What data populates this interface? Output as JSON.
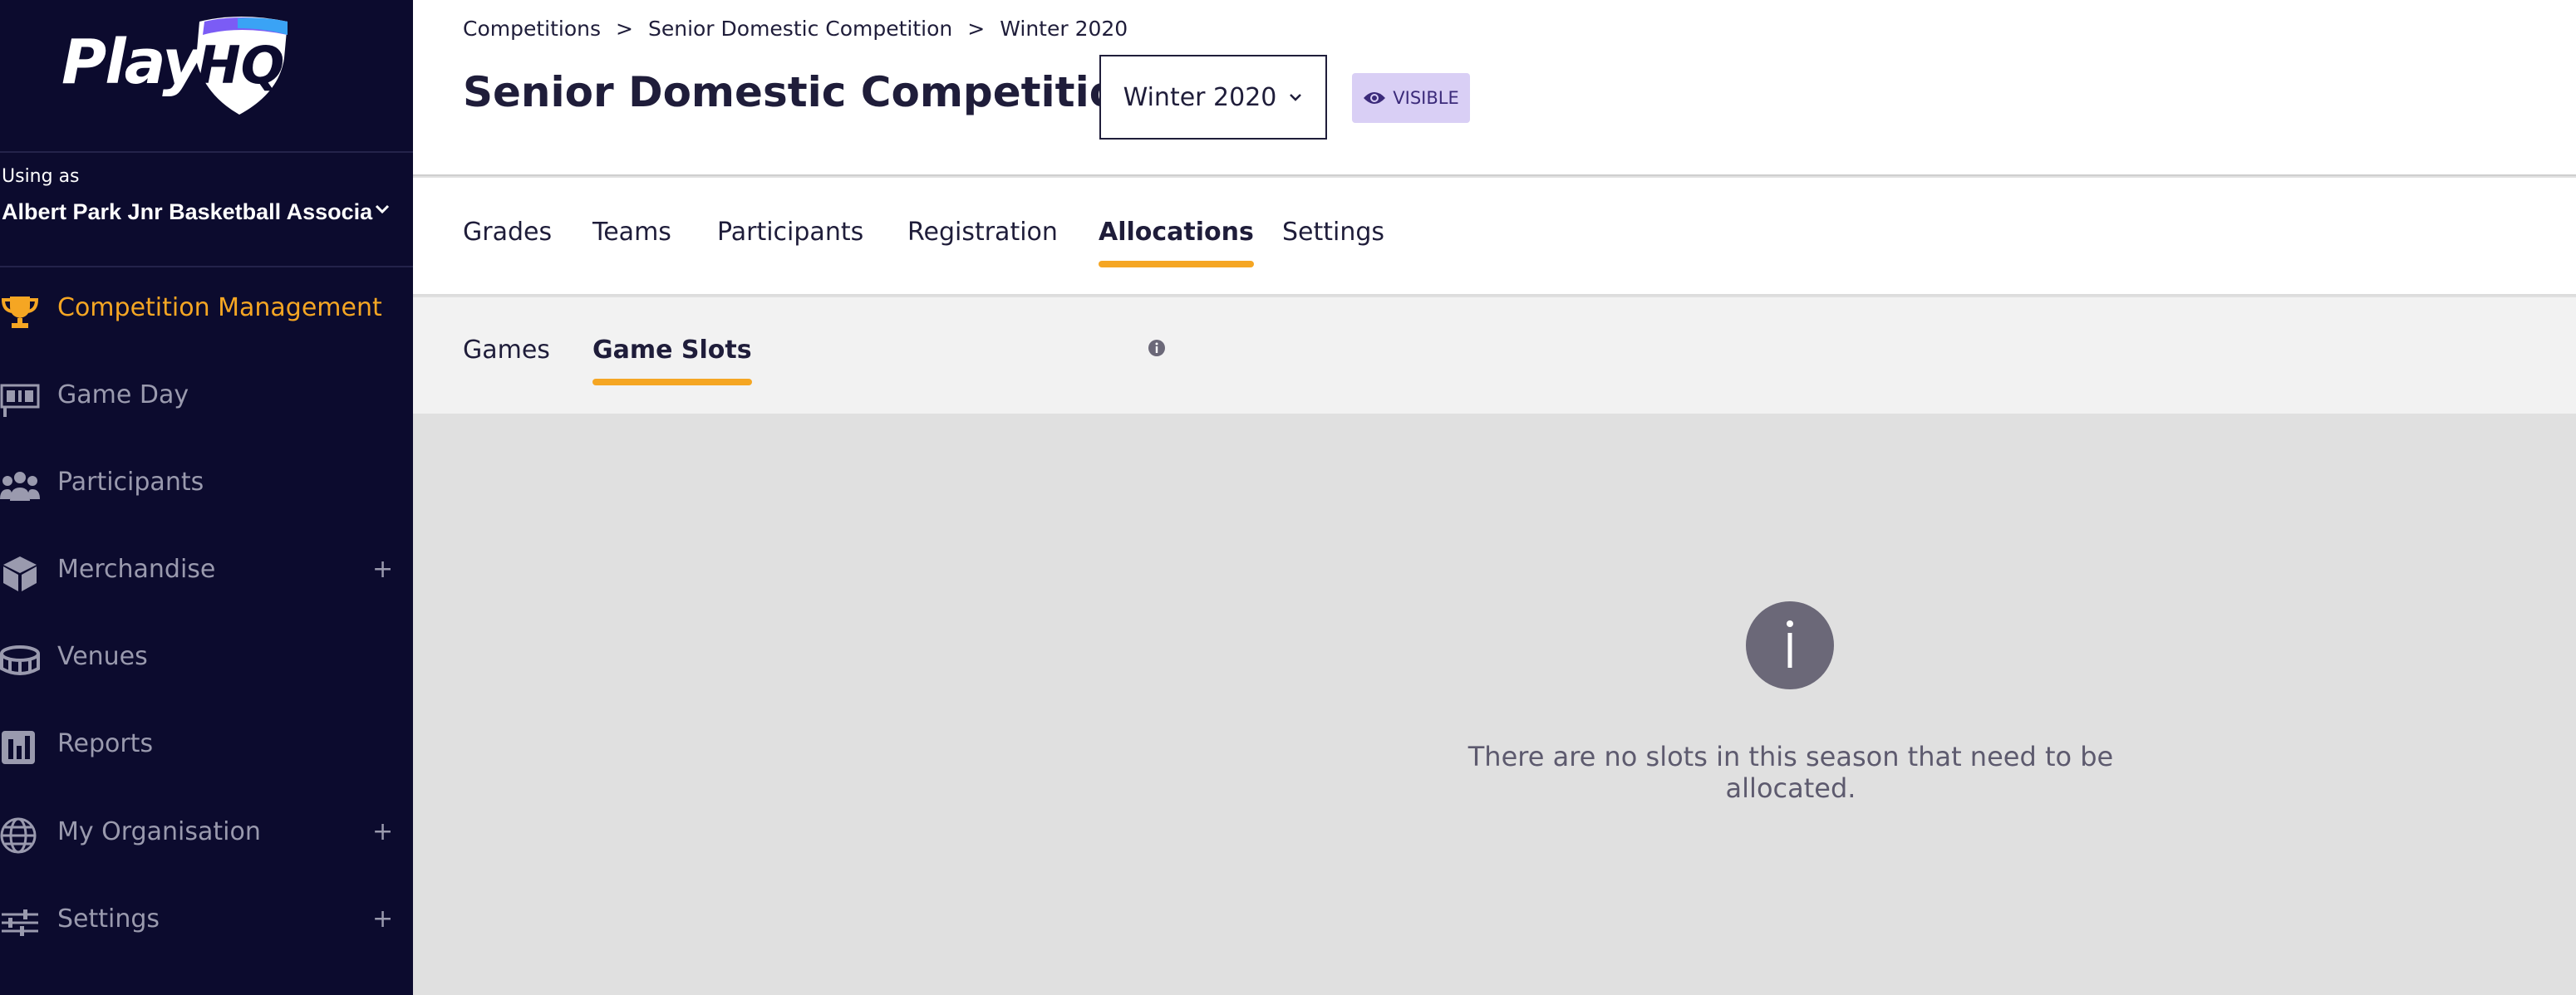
{
  "brand": {
    "logo_text": "PlayHQ",
    "accent": "#f5a623",
    "sidebar_bg": "#0c0b2e"
  },
  "sidebar": {
    "using_as_label": "Using as",
    "org_name": "Albert Park Jnr Basketball Associa",
    "items": [
      {
        "label": "Competition Management",
        "icon": "trophy-icon",
        "active": true,
        "expandable": false
      },
      {
        "label": "Game Day",
        "icon": "scoreboard-icon",
        "active": false,
        "expandable": false
      },
      {
        "label": "Participants",
        "icon": "people-icon",
        "active": false,
        "expandable": false
      },
      {
        "label": "Merchandise",
        "icon": "box-icon",
        "active": false,
        "expandable": true
      },
      {
        "label": "Venues",
        "icon": "stadium-icon",
        "active": false,
        "expandable": false
      },
      {
        "label": "Reports",
        "icon": "bar-chart-icon",
        "active": false,
        "expandable": false
      },
      {
        "label": "My Organisation",
        "icon": "globe-icon",
        "active": false,
        "expandable": true
      },
      {
        "label": "Settings",
        "icon": "sliders-icon",
        "active": false,
        "expandable": true
      }
    ],
    "plus_symbol": "+"
  },
  "header": {
    "breadcrumb": [
      "Competitions",
      "Senior Domestic Competition",
      "Winter 2020"
    ],
    "breadcrumb_sep": ">",
    "title": "Senior Domestic Competition",
    "season_select": "Winter 2020",
    "visibility_badge": "VISIBLE"
  },
  "tabs": [
    {
      "label": "Grades",
      "active": false
    },
    {
      "label": "Teams",
      "active": false
    },
    {
      "label": "Participants",
      "active": false
    },
    {
      "label": "Registration",
      "active": false
    },
    {
      "label": "Allocations",
      "active": true
    },
    {
      "label": "Settings",
      "active": false
    }
  ],
  "subtabs": [
    {
      "label": "Games",
      "active": false
    },
    {
      "label": "Game Slots",
      "active": true
    }
  ],
  "content": {
    "empty_message": "There are no slots in this season that need to be allocated.",
    "empty_icon": "info-icon"
  }
}
